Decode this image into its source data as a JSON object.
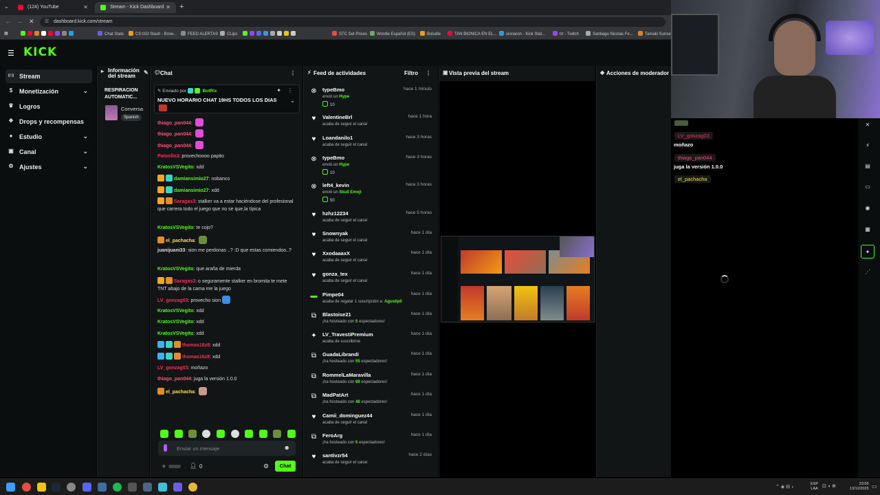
{
  "browser": {
    "tabs": [
      {
        "title": "(124) YouTube",
        "color": "#ff0033"
      },
      {
        "title": "Stream - Kick Dashboard",
        "color": "#53fc18"
      }
    ],
    "url": "dashboard.kick.com/stream",
    "bookmarks": [
      "Chat Stats",
      "CS:GO Stash - Brow...",
      "FEED ALERTAS",
      "CLips",
      "STC Set Prices",
      "Wordle Español (ES)",
      "Boludle",
      "TAN BIONICA EN EL...",
      "sionaron - Kick Stat...",
      "trr - Twitch",
      "Santiago Nicolas Fe...",
      "Tamaki Sunset"
    ]
  },
  "header": {
    "logo": "KICK"
  },
  "nav": {
    "items": [
      {
        "label": "Stream",
        "icon": "broadcast-icon",
        "glyph": "((·))",
        "active": true,
        "chevron": false
      },
      {
        "label": "Monetización",
        "icon": "dollar-icon",
        "glyph": "$",
        "active": false,
        "chevron": true
      },
      {
        "label": "Logros",
        "icon": "trophy-icon",
        "glyph": "♛",
        "active": false,
        "chevron": false
      },
      {
        "label": "Drops y recompensas",
        "icon": "gift-icon",
        "glyph": "❖",
        "active": false,
        "chevron": false
      },
      {
        "label": "Estudio",
        "icon": "studio-icon",
        "glyph": "●",
        "active": false,
        "chevron": true
      },
      {
        "label": "Canal",
        "icon": "channel-icon",
        "glyph": "▣",
        "active": false,
        "chevron": true
      },
      {
        "label": "Ajustes",
        "icon": "gear-icon",
        "glyph": "⚙",
        "active": false,
        "chevron": true
      }
    ]
  },
  "info_panel": {
    "title": "Información del stream",
    "stream_title": "RESPIRACION AUTOMATIC...",
    "category": "Conversa",
    "language": "Spanish"
  },
  "chat": {
    "title": "Chat",
    "pinned": {
      "sent_by_label": "Enviado por",
      "bot": "BotRix",
      "message": "NUEVO HORARIO CHAT 19HS TODOS LOS DIAS"
    },
    "messages": [
      {
        "user": "thiago_pan044",
        "color": "#ff4f7b",
        "text": "",
        "emote": "#e34bd6"
      },
      {
        "user": "thiago_pan044",
        "color": "#ff4f7b",
        "text": "",
        "emote": "#e34bd6"
      },
      {
        "user": "thiago_pan044",
        "color": "#ff4f7b",
        "text": "",
        "emote": "#e34bd6"
      },
      {
        "user": "Patoollo3",
        "color": "#ff2d55",
        "text": "provechoooo papito"
      },
      {
        "user": "KratosVSVegito",
        "color": "#53fc18",
        "text": "xdd"
      },
      {
        "user": "damiansimio27",
        "color": "#53fc18",
        "text": "nobanco",
        "badges": [
          "#f5a623",
          "#3bd4c8"
        ]
      },
      {
        "user": "damiansimio27",
        "color": "#53fc18",
        "text": "xdd",
        "badges": [
          "#f5a623",
          "#3bd4c8"
        ]
      },
      {
        "user": "Saragas3",
        "color": "#ff2d55",
        "text": "stalker va a estar haciéndose del profesional que carrera todo el juego que no se que,la típica",
        "badges": [
          "#f5a623",
          "#e38d2a"
        ]
      },
      {
        "user": "KratosVSVegito",
        "color": "#53fc18",
        "text": "te cojo?"
      },
      {
        "user": "el_pachacha",
        "color": "#f5e04b",
        "text": "",
        "badges": [
          "#e38d2a"
        ],
        "emote": "#6b8e3a"
      },
      {
        "user": "juanijuani33",
        "color": "#dddddd",
        "text": "sion me perdonas ..? :D que estas comiendoo..?"
      },
      {
        "user": "KratosVSVegito",
        "color": "#53fc18",
        "text": "que araña de mierda"
      },
      {
        "user": "Saragas3",
        "color": "#ff2d55",
        "text": "o seguramente stalker en bromita te mete TNT abajo de la cama me la juego",
        "badges": [
          "#f5a623",
          "#e38d2a"
        ]
      },
      {
        "user": "LV_gonzag03",
        "color": "#ff2d55",
        "text": "provecho sion",
        "emote": "#3a8ee3"
      },
      {
        "user": "KratosVSVegito",
        "color": "#53fc18",
        "text": "xdd"
      },
      {
        "user": "KratosVSVegito",
        "color": "#53fc18",
        "text": "xdd"
      },
      {
        "user": "KratosVSVegito",
        "color": "#53fc18",
        "text": "xdd"
      },
      {
        "user": "thomas16z8",
        "color": "#ff2d55",
        "text": "xdd",
        "badges": [
          "#3bb0f5",
          "#3bd4c8",
          "#e38d2a"
        ]
      },
      {
        "user": "thomas16z8",
        "color": "#ff2d55",
        "text": "xdd",
        "badges": [
          "#3bb0f5",
          "#3bd4c8",
          "#e38d2a"
        ]
      },
      {
        "user": "LV_gonzag03",
        "color": "#ff2d55",
        "text": "moñazo"
      },
      {
        "user": "thiago_pan044",
        "color": "#ff4f7b",
        "text": "juga la versión 1.0.0"
      },
      {
        "user": "el_pachacha",
        "color": "#f5e04b",
        "text": "",
        "badges": [
          "#e38d2a"
        ],
        "emote": "#c89a8a"
      }
    ],
    "input_placeholder": "Enviar un mensaje",
    "kicks_count": "0",
    "send_label": "Chat"
  },
  "activity": {
    "title": "Feed de actividades",
    "filter_label": "Filtro",
    "items": [
      {
        "name": "typeBmo",
        "time": "hace 1 minuto",
        "icon": "kick-icon",
        "glyph": "⊗",
        "sub": "envió un",
        "highlight": "Hype",
        "kicks": "10"
      },
      {
        "name": "ValentineBrl",
        "time": "hace 1 hora",
        "icon": "heart-icon",
        "glyph": "♥",
        "sub": "acaba de seguir el canal"
      },
      {
        "name": "Loandanilo1",
        "time": "hace 3 horas",
        "icon": "heart-icon",
        "glyph": "♥",
        "sub": "acaba de seguir el canal"
      },
      {
        "name": "typeBmo",
        "time": "hace 3 horas",
        "icon": "kick-icon",
        "glyph": "⊗",
        "sub": "envió un",
        "highlight": "Hype",
        "kicks": "10"
      },
      {
        "name": "left4_kevin",
        "time": "hace 3 horas",
        "icon": "kick-icon",
        "glyph": "⊗",
        "sub": "envió un",
        "highlight": "Skull Emoji",
        "kicks": "50"
      },
      {
        "name": "hzhz12234",
        "time": "hace 5 horas",
        "icon": "heart-icon",
        "glyph": "♥",
        "sub": "acaba de seguir el canal"
      },
      {
        "name": "Snownyak",
        "time": "hace 1 día",
        "icon": "heart-icon",
        "glyph": "♥",
        "sub": "acaba de seguir el canal"
      },
      {
        "name": "XxodaaaxX",
        "time": "hace 1 día",
        "icon": "heart-icon",
        "glyph": "♥",
        "sub": "acaba de seguir el canal"
      },
      {
        "name": "gonza_tex",
        "time": "hace 1 día",
        "icon": "heart-icon",
        "glyph": "♥",
        "sub": "acaba de seguir el canal"
      },
      {
        "name": "Pimpe04",
        "time": "hace 1 día",
        "icon": "gift-sub-icon",
        "glyph": "▬",
        "sub": "acaba de regalar 1 suscripción a:",
        "highlight": "Agustip0"
      },
      {
        "name": "Blastoise21",
        "time": "hace 1 día",
        "icon": "host-icon",
        "glyph": "⧉",
        "sub": "¡ha hosteado con",
        "highlight": "5",
        "sub_after": "espectadores!"
      },
      {
        "name": "LV_TravestiPremium",
        "time": "hace 1 día",
        "icon": "star-icon",
        "glyph": "✦",
        "sub": "acaba de suscribirse"
      },
      {
        "name": "GuadaLibrandi",
        "time": "hace 1 día",
        "icon": "host-icon",
        "glyph": "⧉",
        "sub": "¡ha hosteado con",
        "highlight": "55",
        "sub_after": "espectadores!"
      },
      {
        "name": "RommelLaMaravilla",
        "time": "hace 1 día",
        "icon": "host-icon",
        "glyph": "⧉",
        "sub": "¡ha hosteado con",
        "highlight": "69",
        "sub_after": "espectadores!"
      },
      {
        "name": "MadPatArt",
        "time": "hace 1 día",
        "icon": "host-icon",
        "glyph": "⧉",
        "sub": "¡ha hosteado con",
        "highlight": "48",
        "sub_after": "espectadores!"
      },
      {
        "name": "Camii_dominguez44",
        "time": "hace 1 día",
        "icon": "heart-icon",
        "glyph": "♥",
        "sub": "acaba de seguir el canal"
      },
      {
        "name": "FeroArg",
        "time": "hace 1 día",
        "icon": "host-icon",
        "glyph": "⧉",
        "sub": "¡ha hosteado con",
        "highlight": "5",
        "sub_after": "espectadores!"
      },
      {
        "name": "santivzr54",
        "time": "hace 2 días",
        "icon": "heart-icon",
        "glyph": "♥",
        "sub": "acaba de seguir el canal"
      }
    ]
  },
  "preview": {
    "title": "Vista previa del stream"
  },
  "mod_actions": {
    "title": "Acciones de moderador"
  },
  "overlay_chat": [
    {
      "user": "LV_gonzag03",
      "color": "#ff2d55",
      "text": "moñazo"
    },
    {
      "user": "thiago_pan044",
      "color": "#ff4f7b",
      "text": "juga la versión 1.0.0"
    },
    {
      "user": "el_pachacha",
      "color": "#f5e04b",
      "text": ""
    }
  ],
  "taskbar": {
    "lang1": "ESP",
    "lang2": "LAA",
    "time": "23:05",
    "date": "13/12/2025"
  }
}
